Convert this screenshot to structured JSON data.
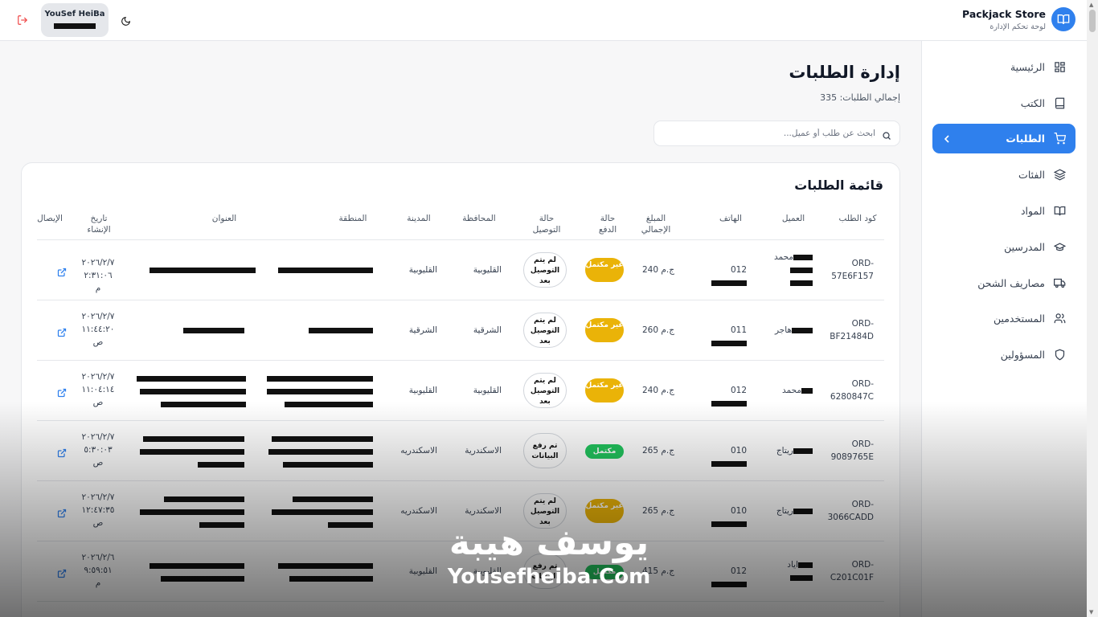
{
  "brand": {
    "name": "Packjack Store",
    "subtitle": "لوحة تحكم الإدارة"
  },
  "user": {
    "name": "YouSef HeiBa"
  },
  "sidebar": {
    "items": [
      {
        "label": "الرئيسية",
        "icon": "dashboard-icon",
        "active": false
      },
      {
        "label": "الكتب",
        "icon": "book-icon",
        "active": false
      },
      {
        "label": "الطلبات",
        "icon": "cart-icon",
        "active": true
      },
      {
        "label": "الفئات",
        "icon": "layers-icon",
        "active": false
      },
      {
        "label": "المواد",
        "icon": "open-book-icon",
        "active": false
      },
      {
        "label": "المدرسين",
        "icon": "graduation-cap-icon",
        "active": false
      },
      {
        "label": "مصاريف الشحن",
        "icon": "truck-icon",
        "active": false
      },
      {
        "label": "المستخدمين",
        "icon": "users-icon",
        "active": false
      },
      {
        "label": "المسؤولين",
        "icon": "shield-icon",
        "active": false
      }
    ]
  },
  "page": {
    "title": "إدارة الطلبات",
    "subtitle": "إجمالي الطلبات: 335",
    "search_placeholder": "ابحث عن طلب أو عميل...",
    "card_title": "قائمة الطلبات"
  },
  "table": {
    "headers": {
      "code": "كود الطلب",
      "customer": "العميل",
      "phone": "الهاتف",
      "amount": "المبلغ الإجمالي",
      "payment": "حالة الدفع",
      "delivery": "حالة التوصيل",
      "governorate": "المحافظة",
      "city": "المدينة",
      "region": "المنطقة",
      "address": "العنوان",
      "created": "تاريخ الإنشاء",
      "receipt": "الإيصال"
    },
    "rows": [
      {
        "code": "ORD-57E6F157",
        "customer": "محمد",
        "phone": "012",
        "amount": "240 ج.م",
        "payment": "غير مكتمل",
        "payment_status": "unpaid",
        "delivery": "لم يتم التوصيل بعد",
        "governorate": "القليوبية",
        "city": "القليوبية",
        "created": "٢٠٢٦/٢/٧ ٢:٣١:٠٦ م"
      },
      {
        "code": "ORD-BF21484D",
        "customer": "هاجر",
        "phone": "011",
        "amount": "260 ج.م",
        "payment": "غير مكتمل",
        "payment_status": "unpaid",
        "delivery": "لم يتم التوصيل بعد",
        "governorate": "الشرقية",
        "city": "الشرقية",
        "created": "٢٠٢٦/٢/٧ ١١:٤٤:٢٠ ص"
      },
      {
        "code": "ORD-6280847C",
        "customer": "محمد",
        "phone": "012",
        "amount": "240 ج.م",
        "payment": "غير مكتمل",
        "payment_status": "unpaid",
        "delivery": "لم يتم التوصيل بعد",
        "governorate": "القليوبية",
        "city": "القليوبية",
        "created": "٢٠٢٦/٢/٧ ١١:٠٤:١٤ ص"
      },
      {
        "code": "ORD-9089765E",
        "customer": "ريتاج",
        "phone": "010",
        "amount": "265 ج.م",
        "payment": "مكتمل",
        "payment_status": "paid",
        "delivery": "تم رفع البيانات",
        "governorate": "الاسكندرية",
        "city": "الاسكندريه",
        "created": "٢٠٢٦/٢/٧ ٥:٣٠:٠٣ ص"
      },
      {
        "code": "ORD-3066CADD",
        "customer": "ريتاج",
        "phone": "010",
        "amount": "265 ج.م",
        "payment": "غير مكتمل",
        "payment_status": "unpaid",
        "delivery": "لم يتم التوصيل بعد",
        "governorate": "الاسكندرية",
        "city": "الاسكندريه",
        "created": "٢٠٢٦/٢/٧ ١٢:٤٧:٣٥ ص"
      },
      {
        "code": "ORD-C201C01F",
        "customer": "اياد",
        "phone": "012",
        "amount": "415 ج.م",
        "payment": "مكتمل",
        "payment_status": "paid",
        "delivery": "تم رفع البيانات",
        "governorate": "القليوبية",
        "city": "القليوبية",
        "created": "٢٠٢٦/٢/٦ ٩:٥٩:٥١ م"
      }
    ]
  },
  "watermark": {
    "arabic": "يوسف هيبة",
    "english": "Yousefheiba.Com"
  },
  "colors": {
    "accent": "#2f80ed",
    "unpaid": "#eab308",
    "paid": "#22c55e",
    "logout": "#ef4444"
  }
}
